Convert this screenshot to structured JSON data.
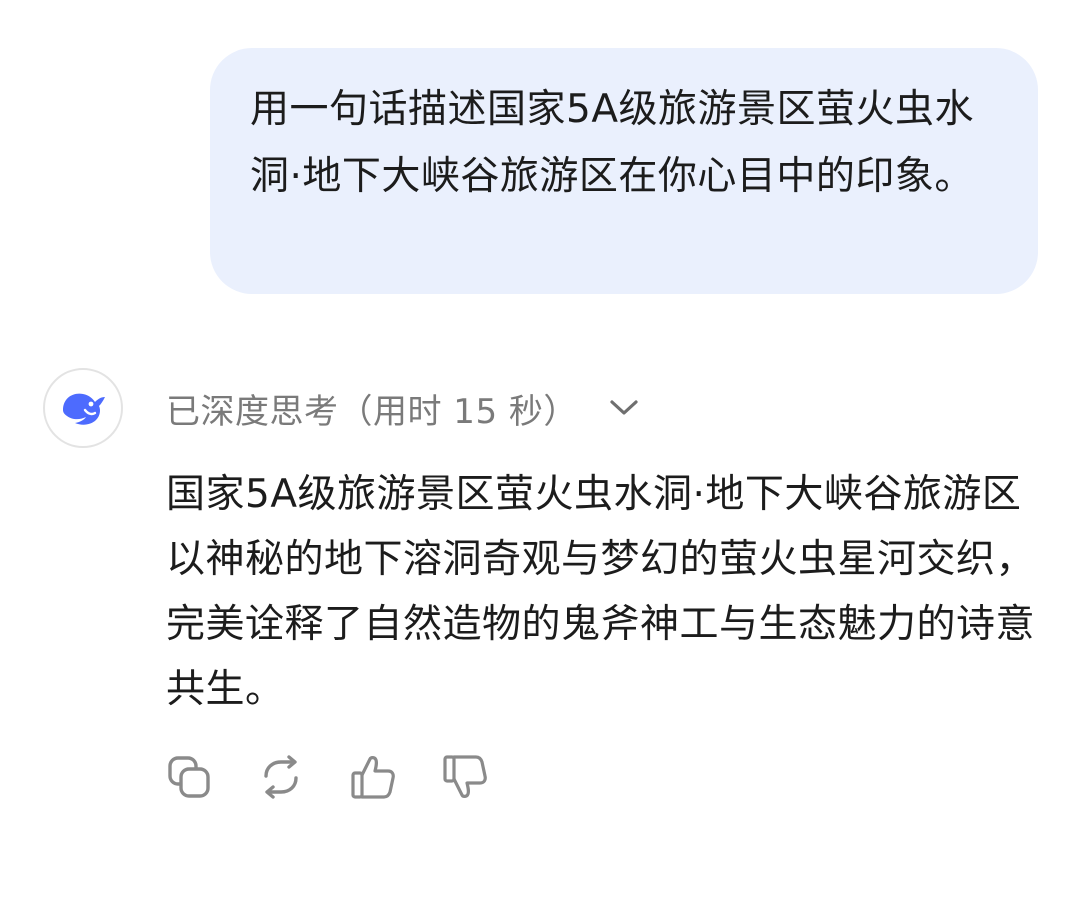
{
  "user_message": {
    "text": "用一句话描述国家5A级旅游景区萤火虫水洞·地下大峡谷旅游区在你心目中的印象。"
  },
  "assistant": {
    "avatar_icon": "deepseek-whale-logo",
    "thinking_label": "已深度思考（用时 15 秒）",
    "answer_text": "国家5A级旅游景区萤火虫水洞·地下大峡谷旅游区以神秘的地下溶洞奇观与梦幻的萤火虫星河交织，完美诠释了自然造物的鬼斧神工与生态魅力的诗意共生。"
  },
  "actions": [
    {
      "icon": "copy-icon"
    },
    {
      "icon": "regenerate-icon"
    },
    {
      "icon": "thumbs-up-icon"
    },
    {
      "icon": "thumbs-down-icon"
    }
  ],
  "colors": {
    "bubble_bg": "#eaf0fd",
    "logo_blue": "#4d6bfe",
    "muted_text": "#7a7a7a",
    "icon_gray": "#8a8a8a"
  }
}
